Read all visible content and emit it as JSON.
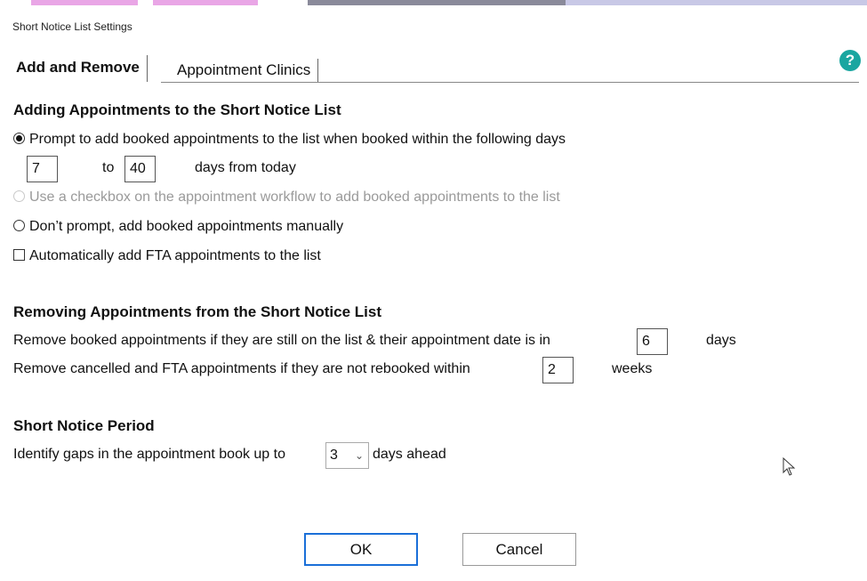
{
  "window": {
    "title": "Short Notice List Settings"
  },
  "tabs": [
    {
      "label": "Add and Remove"
    },
    {
      "label": "Appointment Clinics"
    }
  ],
  "help": {
    "glyph": "?"
  },
  "adding": {
    "heading": "Adding Appointments to the Short Notice List",
    "option_prompt": "Prompt to add booked appointments to the list when booked within the following days",
    "from_value": "7",
    "to_label": "to",
    "to_value": "40",
    "days_from_today": "days from today",
    "option_checkbox": "Use a checkbox on the appointment workflow to add booked appointments to the list",
    "option_manual": "Don’t prompt, add booked appointments manually",
    "auto_fta": "Automatically add FTA appointments to the list"
  },
  "removing": {
    "heading": "Removing Appointments from the Short Notice List",
    "booked_text": "Remove booked appointments if they are still on the list & their appointment date is in",
    "booked_value": "6",
    "booked_unit": "days",
    "cancelled_text": "Remove cancelled and FTA appointments if they are not rebooked within",
    "cancelled_value": "2",
    "cancelled_unit": "weeks"
  },
  "period": {
    "heading": "Short Notice Period",
    "text": "Identify gaps in the appointment book up to",
    "selected": "3",
    "suffix": "days ahead"
  },
  "buttons": {
    "ok": "OK",
    "cancel": "Cancel"
  },
  "colors": {
    "accent": "#1a6fd8",
    "help": "#1aa6a0",
    "disabled": "#9a9a9a"
  }
}
